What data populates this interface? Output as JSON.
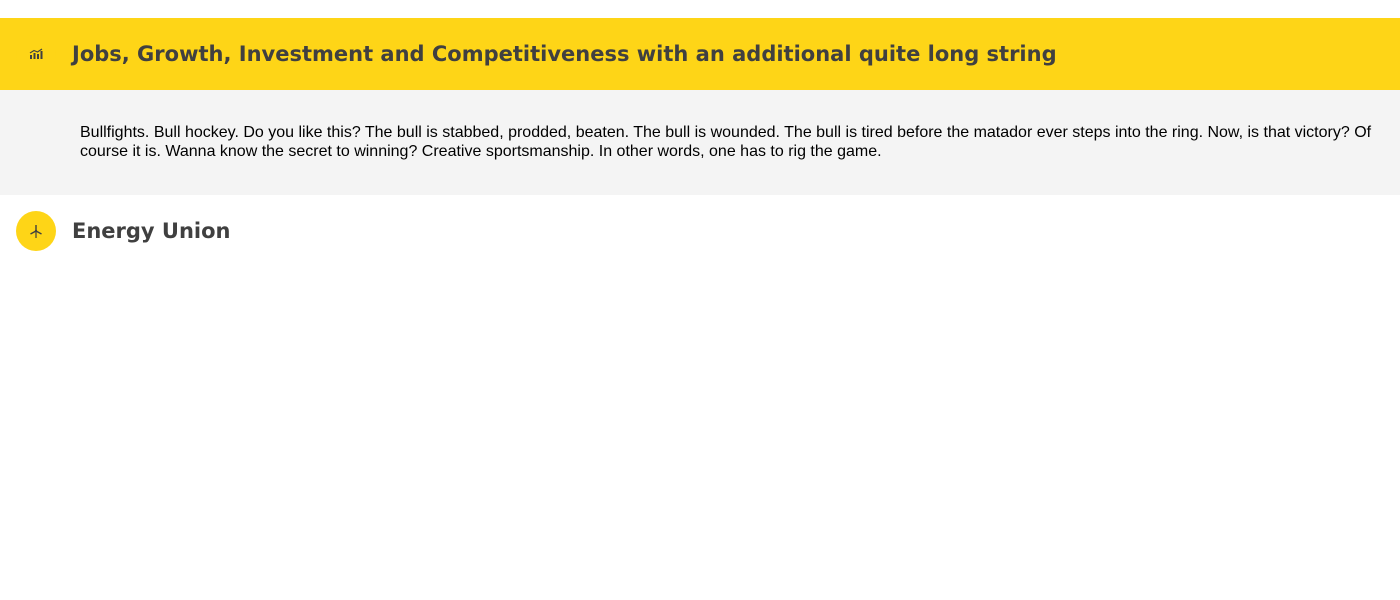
{
  "accordion": {
    "items": [
      {
        "title": "Jobs, Growth, Investment and Competitiveness with an additional quite long string",
        "icon": "growth-chart-icon",
        "expanded": true,
        "body": "Bullfights. Bull hockey. Do you like this? The bull is stabbed, prodded, beaten. The bull is wounded. The bull is tired before the matador ever steps into the ring. Now, is that victory? Of course it is. Wanna know the secret to winning? Creative sportsmanship. In other words, one has to rig the game."
      },
      {
        "title": "Energy Union",
        "icon": "wind-turbine-icon",
        "expanded": false
      }
    ]
  },
  "colors": {
    "accent": "#fed517",
    "panel_bg": "#f4f4f4",
    "heading_text": "#404040",
    "body_text": "#000000"
  }
}
